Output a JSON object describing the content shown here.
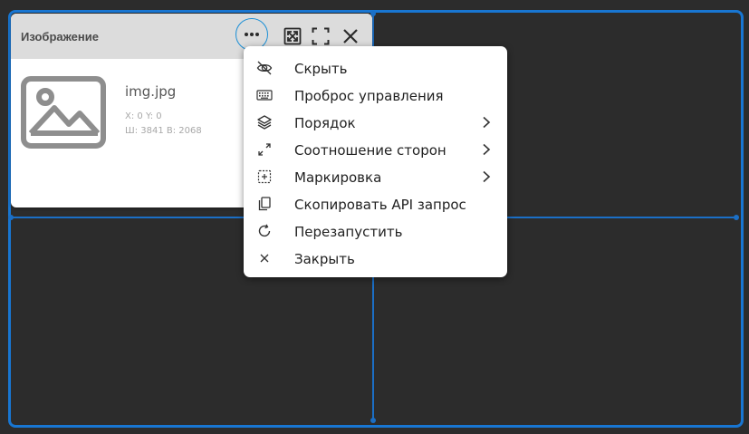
{
  "widget": {
    "title": "Изображение",
    "file_name": "img.jpg",
    "position_text": "X: 0 Y: 0",
    "size_text": "Ш: 3841 В: 2068"
  },
  "icons": {
    "more": "more-horizontal-icon",
    "expand": "expand-arrows-icon",
    "fullscreen": "fullscreen-corners-icon",
    "close": "close-icon",
    "thumbnail": "image-placeholder-icon"
  },
  "menu": {
    "items": [
      {
        "label": "Скрыть",
        "icon": "eye-off-icon",
        "submenu": false
      },
      {
        "label": "Проброс управления",
        "icon": "keyboard-icon",
        "submenu": false
      },
      {
        "label": "Порядок",
        "icon": "layers-icon",
        "submenu": true
      },
      {
        "label": "Соотношение сторон",
        "icon": "resize-diagonal-icon",
        "submenu": true
      },
      {
        "label": "Маркировка",
        "icon": "crosshair-box-icon",
        "submenu": true
      },
      {
        "label": "Скопировать API запрос",
        "icon": "copy-icon",
        "submenu": false
      },
      {
        "label": "Перезапустить",
        "icon": "restart-icon",
        "submenu": false
      },
      {
        "label": "Закрыть",
        "icon": "close-icon",
        "submenu": false
      }
    ]
  },
  "colors": {
    "background": "#2c2c2c",
    "frame_accent": "#1876d2",
    "focus_ring": "#1a8fd6",
    "card_header": "#dcdcdc"
  }
}
